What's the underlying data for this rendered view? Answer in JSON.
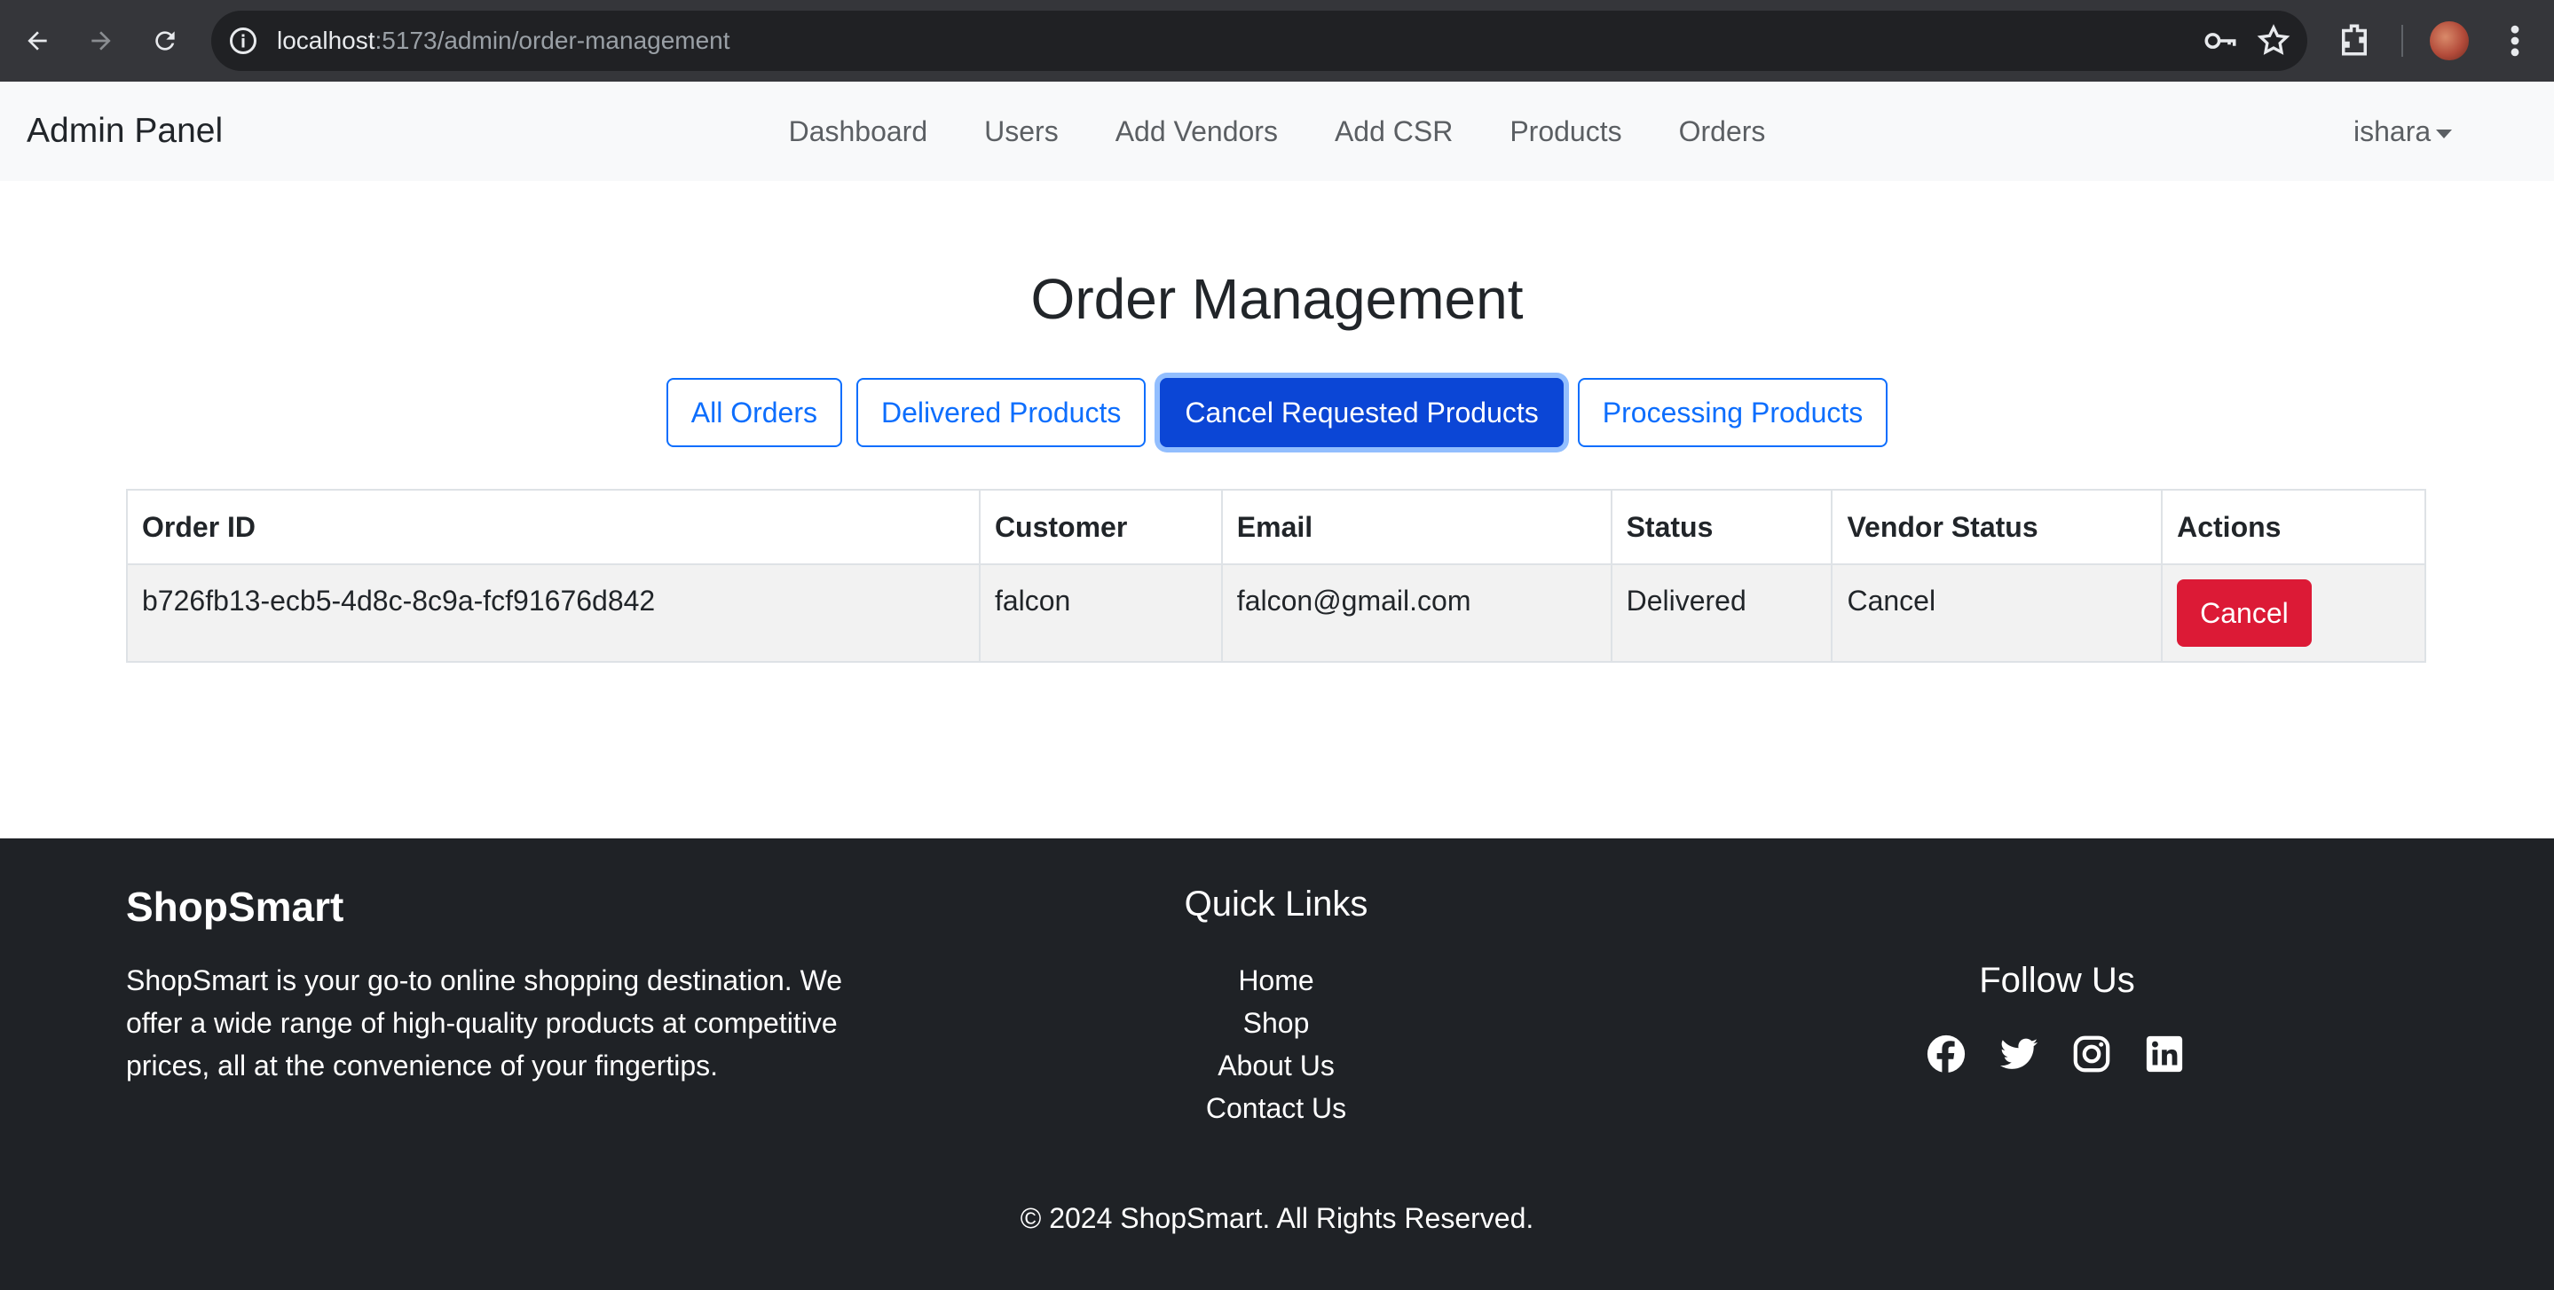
{
  "browser": {
    "url_host": "localhost",
    "url_path": ":5173/admin/order-management"
  },
  "navbar": {
    "brand": "Admin Panel",
    "links": [
      "Dashboard",
      "Users",
      "Add Vendors",
      "Add CSR",
      "Products",
      "Orders"
    ],
    "user": "ishara"
  },
  "main": {
    "title": "Order Management",
    "filters": [
      "All Orders",
      "Delivered Products",
      "Cancel Requested Products",
      "Processing Products"
    ],
    "active_filter": "Cancel Requested Products",
    "table": {
      "headers": [
        "Order ID",
        "Customer",
        "Email",
        "Status",
        "Vendor Status",
        "Actions"
      ],
      "rows": [
        {
          "order_id": "b726fb13-ecb5-4d8c-8c9a-fcf91676d842",
          "customer": "falcon",
          "email": "falcon@gmail.com",
          "status": "Delivered",
          "vendor_status": "Cancel",
          "action": "Cancel"
        }
      ]
    }
  },
  "footer": {
    "brand": "ShopSmart",
    "description": "ShopSmart is your go-to online shopping destination. We offer a wide range of high-quality products at competitive prices, all at the convenience of your fingertips.",
    "quick_links_title": "Quick Links",
    "quick_links": [
      "Home",
      "Shop",
      "About Us",
      "Contact Us"
    ],
    "follow_title": "Follow Us",
    "social_icons": [
      "facebook-icon",
      "twitter-icon",
      "instagram-icon",
      "linkedin-icon"
    ],
    "copyright": "© 2024 ShopSmart. All Rights Reserved."
  },
  "colors": {
    "primary": "#0d6efd",
    "active_button": "#0b46d6",
    "danger": "#dc1a36",
    "footer_bg": "#1f2226",
    "navbar_bg": "#f8f9fa"
  }
}
